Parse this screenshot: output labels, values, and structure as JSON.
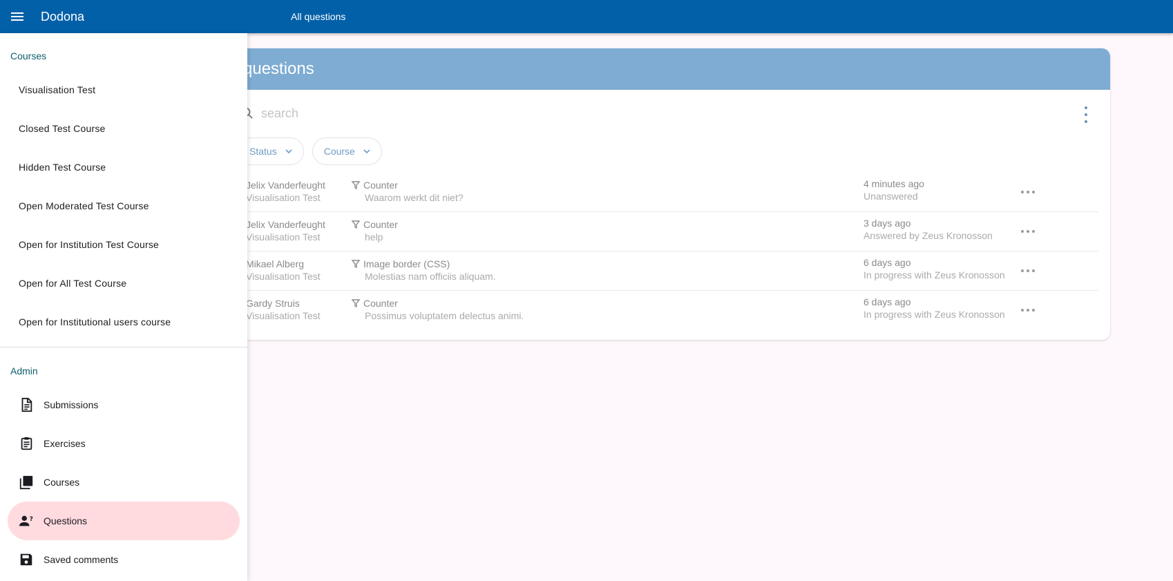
{
  "app": {
    "brand": "Dodona",
    "page_title": "All questions"
  },
  "card": {
    "title": "questions",
    "search_placeholder": "search",
    "filters": [
      {
        "label": "Status"
      },
      {
        "label": "Course"
      }
    ]
  },
  "questions": [
    {
      "user": "Jelix Vanderfeught",
      "course": "Visualisation Test",
      "exercise": "Counter",
      "message": "Waarom werkt dit niet?",
      "time": "4 minutes ago",
      "status": "Unanswered"
    },
    {
      "user": "Jelix Vanderfeught",
      "course": "Visualisation Test",
      "exercise": "Counter",
      "message": "help",
      "time": "3 days ago",
      "status": "Answered by Zeus Kronosson"
    },
    {
      "user": "Mikael Alberg",
      "course": "Visualisation Test",
      "exercise": "Image border (CSS)",
      "message": "Molestias nam officiis aliquam.",
      "time": "6 days ago",
      "status": "In progress with Zeus Kronosson"
    },
    {
      "user": "Gardy Struis",
      "course": "Visualisation Test",
      "exercise": "Counter",
      "message": "Possimus voluptatem delectus animi.",
      "time": "6 days ago",
      "status": "In progress with Zeus Kronosson"
    }
  ],
  "drawer": {
    "courses_title": "Courses",
    "courses": [
      {
        "label": "Visualisation Test"
      },
      {
        "label": "Closed Test Course"
      },
      {
        "label": "Hidden Test Course"
      },
      {
        "label": "Open Moderated Test Course"
      },
      {
        "label": "Open for Institution Test Course"
      },
      {
        "label": "Open for All Test Course"
      },
      {
        "label": "Open for Institutional users course"
      }
    ],
    "admin_title": "Admin",
    "admin": [
      {
        "label": "Submissions",
        "icon": "submissions-icon"
      },
      {
        "label": "Exercises",
        "icon": "exercises-icon"
      },
      {
        "label": "Courses",
        "icon": "courses-icon"
      },
      {
        "label": "Questions",
        "icon": "questions-icon",
        "active": true
      },
      {
        "label": "Saved comments",
        "icon": "saved-comments-icon"
      }
    ]
  },
  "colors": {
    "appbar": "#0260a8",
    "card_header": "#7eacd2",
    "active_nav": "#ffdbe0"
  }
}
